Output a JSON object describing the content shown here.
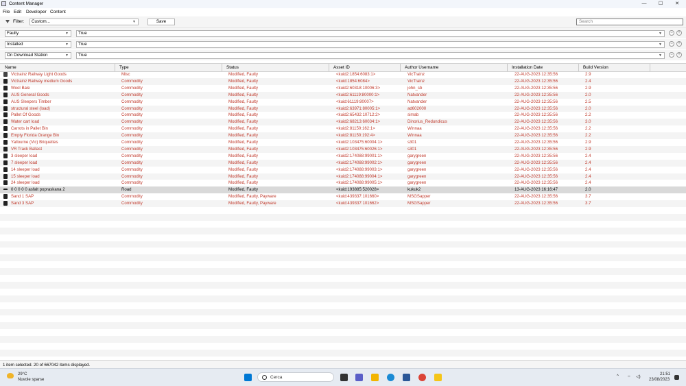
{
  "window": {
    "title": "Content Manager",
    "minimize_glyph": "—",
    "maximize_glyph": "☐",
    "close_glyph": "✕"
  },
  "menu": [
    "File",
    "Edit",
    "Developer",
    "Content"
  ],
  "filter": {
    "label": "Filter:",
    "value": "Custom...",
    "save_label": "Save",
    "search_placeholder": "Search"
  },
  "criteria": [
    {
      "field": "Faulty",
      "value": "True"
    },
    {
      "field": "Installed",
      "value": "True"
    },
    {
      "field": "On Download Station",
      "value": "True"
    }
  ],
  "columns": [
    "Name",
    "Type",
    "Status",
    "Asset ID",
    "Author Username",
    "Installation Date",
    "Build Version"
  ],
  "rows": [
    {
      "name": "Victrainz Railway Light Goods",
      "type": "Misc",
      "status": "Modified, Faulty",
      "asset_id": "<kuid2:1854:6083:1>",
      "author": "VicTrainz",
      "date": "22-AUG-2023 12:35:56",
      "build": "2.9",
      "icon": "misc"
    },
    {
      "name": "Victrainz Railway medium Goods",
      "type": "Commodity",
      "status": "Modified, Faulty",
      "asset_id": "<kuid:1854:6084>",
      "author": "VicTrainz",
      "date": "22-AUG-2023 12:35:56",
      "build": "2.4",
      "icon": "commodity"
    },
    {
      "name": "Wool Bale",
      "type": "Commodity",
      "status": "Modified, Faulty",
      "asset_id": "<kuid2:60318:10006:3>",
      "author": "john_sb",
      "date": "22-AUG-2023 12:35:56",
      "build": "2.9",
      "icon": "commodity"
    },
    {
      "name": "AUS General Goods",
      "type": "Commodity",
      "status": "Modified, Faulty",
      "asset_id": "<kuid2:61119:80000:1>",
      "author": "Natvander",
      "date": "22-AUG-2023 12:35:56",
      "build": "2.0",
      "icon": "commodity"
    },
    {
      "name": "AUS Sleepers Timber",
      "type": "Commodity",
      "status": "Modified, Faulty",
      "asset_id": "<kuid:61119:80007>",
      "author": "Natvander",
      "date": "22-AUG-2023 12:35:56",
      "build": "2.5",
      "icon": "commodity"
    },
    {
      "name": "structural steel (load)",
      "type": "Commodity",
      "status": "Modified, Faulty",
      "asset_id": "<kuid2:63971:80005:1>",
      "author": "ad602000",
      "date": "22-AUG-2023 12:35:56",
      "build": "2.0",
      "icon": "commodity"
    },
    {
      "name": "Pallet Of Goods",
      "type": "Commodity",
      "status": "Modified, Faulty",
      "asset_id": "<kuid2:65432:10712:2>",
      "author": "simab",
      "date": "22-AUG-2023 12:35:56",
      "build": "2.2",
      "icon": "commodity"
    },
    {
      "name": "Water cart load",
      "type": "Commodity",
      "status": "Modified, Faulty",
      "asset_id": "<kuid2:68213:60034:1>",
      "author": "Dinorius_Redundicus",
      "date": "22-AUG-2023 12:35:56",
      "build": "3.0",
      "icon": "commodity"
    },
    {
      "name": "Carrots in Pallet Bin",
      "type": "Commodity",
      "status": "Modified, Faulty",
      "asset_id": "<kuid2:81150:162:1>",
      "author": "Winnaa",
      "date": "22-AUG-2023 12:35:56",
      "build": "2.2",
      "icon": "commodity"
    },
    {
      "name": "Empty Florida Orange Bin",
      "type": "Commodity",
      "status": "Modified, Faulty",
      "asset_id": "<kuid2:81150:192:4>",
      "author": "Winnaa",
      "date": "22-AUG-2023 12:35:56",
      "build": "2.2",
      "icon": "commodity"
    },
    {
      "name": "Yallourne (Vic) Briquettes",
      "type": "Commodity",
      "status": "Modified, Faulty",
      "asset_id": "<kuid2:103475:60004:1>",
      "author": "s301",
      "date": "22-AUG-2023 12:35:56",
      "build": "2.9",
      "icon": "commodity"
    },
    {
      "name": "VR Track Ballast",
      "type": "Commodity",
      "status": "Modified, Faulty",
      "asset_id": "<kuid2:103475:60026:1>",
      "author": "s301",
      "date": "22-AUG-2023 12:35:56",
      "build": "2.9",
      "icon": "commodity"
    },
    {
      "name": "3 sleeper load",
      "type": "Commodity",
      "status": "Modified, Faulty",
      "asset_id": "<kuid2:174088:99001:1>",
      "author": "garygreen",
      "date": "22-AUG-2023 12:35:56",
      "build": "2.4",
      "icon": "commodity"
    },
    {
      "name": "7 sleeper load",
      "type": "Commodity",
      "status": "Modified, Faulty",
      "asset_id": "<kuid2:174088:99002:1>",
      "author": "garygreen",
      "date": "22-AUG-2023 12:35:56",
      "build": "2.4",
      "icon": "commodity"
    },
    {
      "name": "14 sleeper load",
      "type": "Commodity",
      "status": "Modified, Faulty",
      "asset_id": "<kuid2:174088:99003:1>",
      "author": "garygreen",
      "date": "22-AUG-2023 12:35:56",
      "build": "2.4",
      "icon": "commodity"
    },
    {
      "name": "15 sleeper load",
      "type": "Commodity",
      "status": "Modified, Faulty",
      "asset_id": "<kuid2:174088:99004:1>",
      "author": "garygreen",
      "date": "22-AUG-2023 12:35:56",
      "build": "2.4",
      "icon": "commodity"
    },
    {
      "name": "24 sleeper load",
      "type": "Commodity",
      "status": "Modified, Faulty",
      "asset_id": "<kuid2:174088:99005:1>",
      "author": "garygreen",
      "date": "22-AUG-2023 12:35:56",
      "build": "2.4",
      "icon": "commodity"
    },
    {
      "name": "0 0 0 0 0 asfalt popraskana 2",
      "type": "Road",
      "status": "Modified, Faulty",
      "asset_id": "<kuid:193885:520028>",
      "author": "kukuk2",
      "date": "13-AUG-2023 16:16:47",
      "build": "2.0",
      "icon": "road",
      "selected": true
    },
    {
      "name": "Sand 1 SAP",
      "type": "Commodity",
      "status": "Modified, Faulty, Payware",
      "asset_id": "<kuid:439337:101660>",
      "author": "MSGSapper",
      "date": "22-AUG-2023 12:35:56",
      "build": "3.7",
      "icon": "commodity"
    },
    {
      "name": "Sand 3 SAP",
      "type": "Commodity",
      "status": "Modified, Faulty, Payware",
      "asset_id": "<kuid:439337:101662>",
      "author": "MSGSapper",
      "date": "22-AUG-2023 12:35:56",
      "build": "3.7",
      "icon": "commodity"
    }
  ],
  "statusbar": {
    "text": "1 item selected. 20 of 667042 items displayed."
  },
  "taskbar": {
    "weather_temp": "29°C",
    "weather_desc": "Nuvole sparse",
    "search_label": "Cerca",
    "time": "21:51",
    "date": "23/08/2023",
    "tray_glyphs": [
      "^",
      "⌔",
      "◁)"
    ],
    "apps": [
      {
        "icon": "file-explorer-icon",
        "color": "#f2b400"
      },
      {
        "icon": "edge-icon",
        "color": "#1a8ad4"
      },
      {
        "icon": "store-icon",
        "color": "#2b5797"
      },
      {
        "icon": "chrome-icon",
        "color": "#db4437"
      },
      {
        "icon": "folder-icon",
        "color": "#f5c518"
      }
    ]
  },
  "colors": {
    "faulty_text": "#c0392b",
    "selected_row": "#d9d9d9"
  }
}
